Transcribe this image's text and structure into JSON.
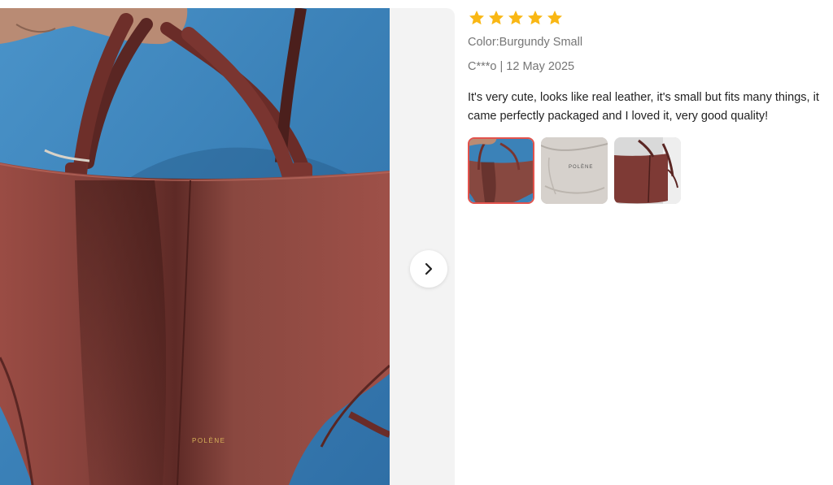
{
  "review": {
    "rating": 5,
    "star_icon": "star-icon",
    "star_color": "#f9b714",
    "color_label": "Color:Burgundy Small",
    "author_date": "C***o | 12 May 2025",
    "text": "It's very cute, looks like real leather, it's small but fits many things, it came perfectly packaged and I loved it, very good quality!",
    "images": [
      {
        "name": "review-photo-bag-front",
        "active": true
      },
      {
        "name": "review-photo-dust-bag",
        "active": false
      },
      {
        "name": "review-photo-bag-side",
        "active": false
      }
    ]
  },
  "viewer": {
    "brand_text": "POLÈNE",
    "next_icon": "chevron-right-icon"
  },
  "thumbs": {
    "dust_bag_brand": "POLÈNE"
  },
  "colors": {
    "leather": "#7e3a35",
    "wall": "#3b82b8",
    "active_border": "#e2524c"
  }
}
